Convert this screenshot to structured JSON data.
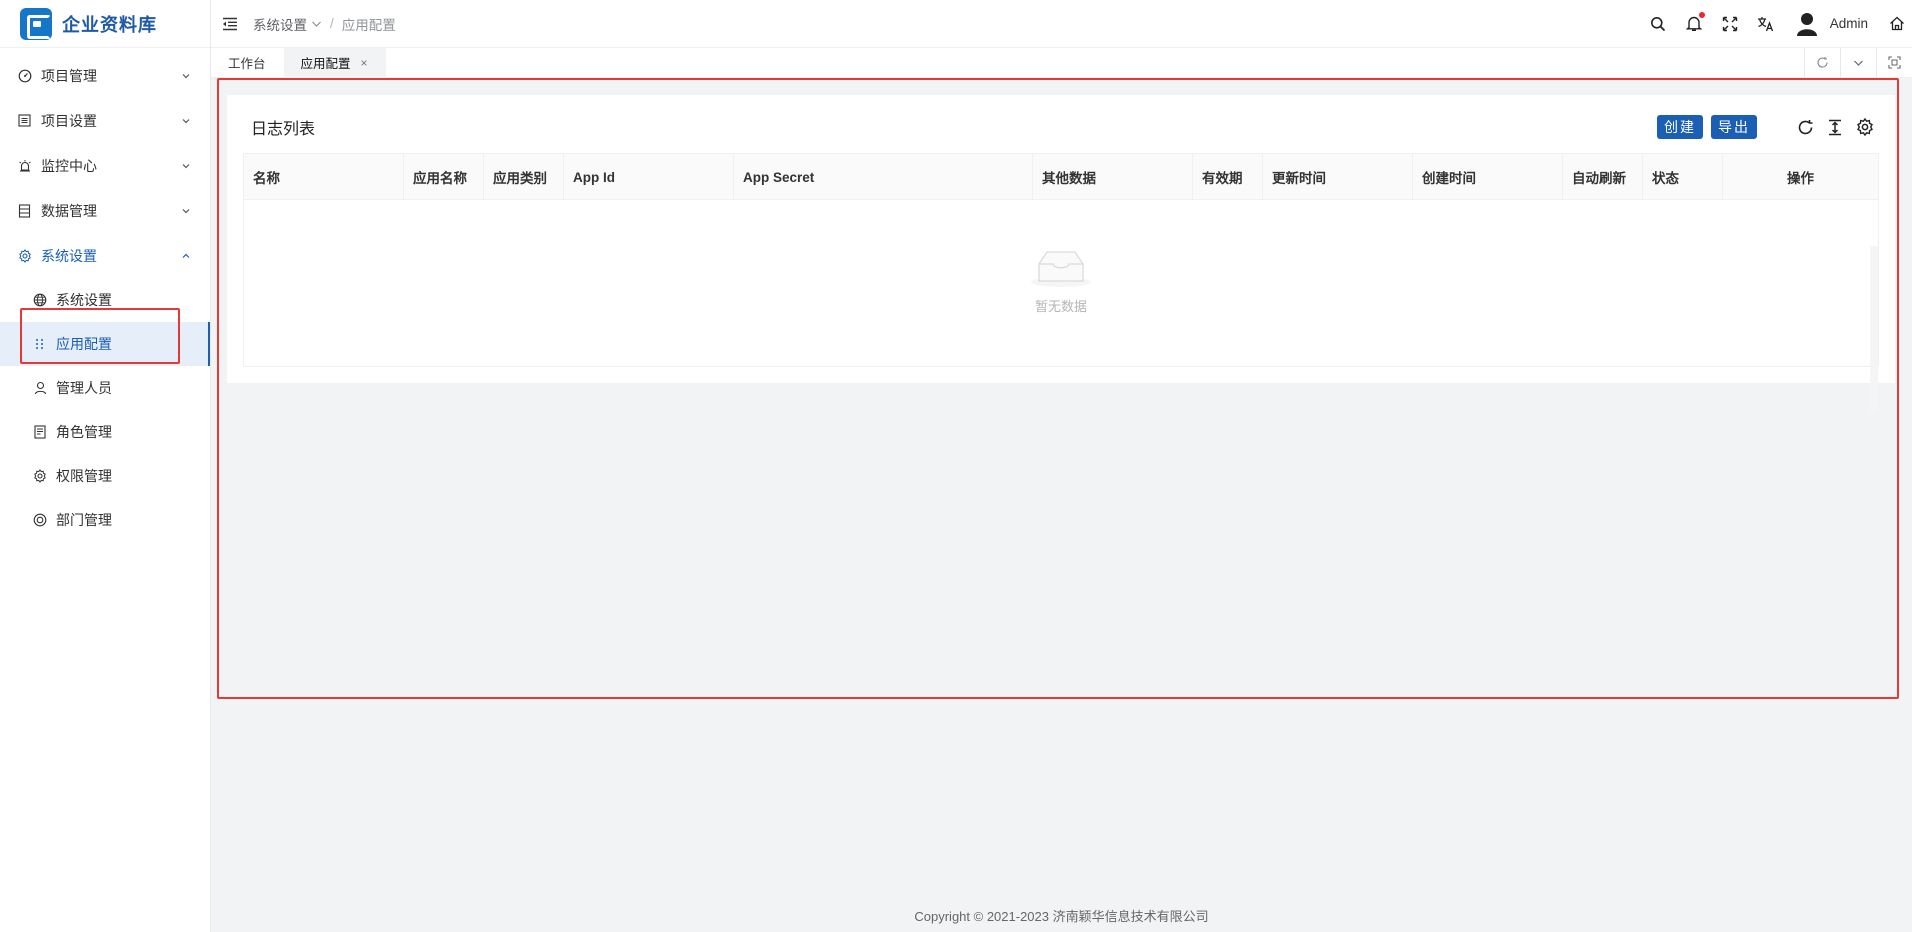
{
  "app": {
    "title": "企业资料库",
    "brand_color": "#1a5fb4"
  },
  "sidebar": {
    "menus": [
      {
        "label": "项目管理",
        "icon": "dashboard-icon",
        "open": false
      },
      {
        "label": "项目设置",
        "icon": "list-icon",
        "open": false
      },
      {
        "label": "监控中心",
        "icon": "alarm-icon",
        "open": false
      },
      {
        "label": "数据管理",
        "icon": "database-icon",
        "open": false
      },
      {
        "label": "系统设置",
        "icon": "gear-icon",
        "open": true
      }
    ],
    "submenus": [
      {
        "label": "系统设置",
        "icon": "globe-icon"
      },
      {
        "label": "应用配置",
        "icon": "grid-dots-icon",
        "active": true
      },
      {
        "label": "管理人员",
        "icon": "user-icon"
      },
      {
        "label": "角色管理",
        "icon": "document-icon"
      },
      {
        "label": "权限管理",
        "icon": "gear-icon"
      },
      {
        "label": "部门管理",
        "icon": "target-icon"
      }
    ]
  },
  "header": {
    "breadcrumb": {
      "parent": "系统设置",
      "sep": "/",
      "current": "应用配置"
    },
    "username": "Admin",
    "has_notification": true
  },
  "tabs": {
    "items": [
      {
        "label": "工作台",
        "active": false
      },
      {
        "label": "应用配置",
        "active": true,
        "closable": true
      }
    ],
    "close_glyph": "×"
  },
  "card": {
    "title": "日志列表",
    "create_label": "创建",
    "export_label": "导出"
  },
  "table": {
    "columns": [
      "名称",
      "应用名称",
      "应用类别",
      "App Id",
      "App Secret",
      "其他数据",
      "有效期",
      "更新时间",
      "创建时间",
      "自动刷新",
      "状态",
      "操作"
    ],
    "rows": [],
    "empty_text": "暂无数据"
  },
  "footer": {
    "copyright": "Copyright © 2021-2023 济南颖华信息技术有限公司"
  }
}
